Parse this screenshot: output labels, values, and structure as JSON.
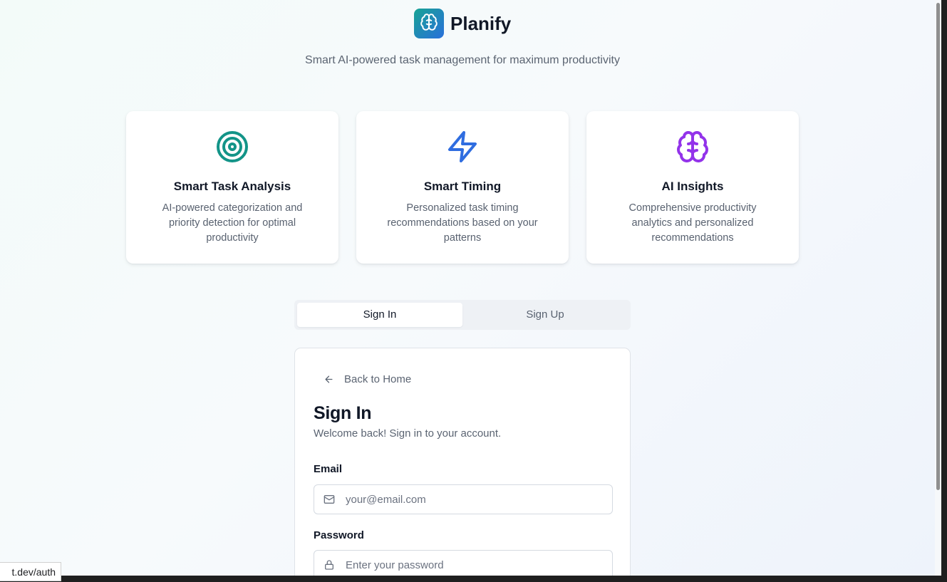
{
  "brand": {
    "name": "Planify",
    "icon": "brain-icon",
    "accent_start": "#17a394",
    "accent_end": "#2a6fdb"
  },
  "tagline": "Smart AI-powered task management for maximum productivity",
  "features": [
    {
      "icon": "target-icon",
      "color": "#139488",
      "title": "Smart Task Analysis",
      "description": "AI-powered categorization and priority detection for optimal productivity"
    },
    {
      "icon": "lightning-icon",
      "color": "#2f6de0",
      "title": "Smart Timing",
      "description": "Personalized task timing recommendations based on your patterns"
    },
    {
      "icon": "brain-icon",
      "color": "#9333ea",
      "title": "AI Insights",
      "description": "Comprehensive productivity analytics and personalized recommendations"
    }
  ],
  "tabs": {
    "signin": "Sign In",
    "signup": "Sign Up",
    "active": "signin"
  },
  "form": {
    "back_label": "Back to Home",
    "title": "Sign In",
    "subtitle": "Welcome back! Sign in to your account.",
    "email_label": "Email",
    "email_placeholder": "your@email.com",
    "password_label": "Password",
    "password_placeholder": "Enter your password"
  },
  "status_bar": {
    "url": "t.dev/auth"
  }
}
